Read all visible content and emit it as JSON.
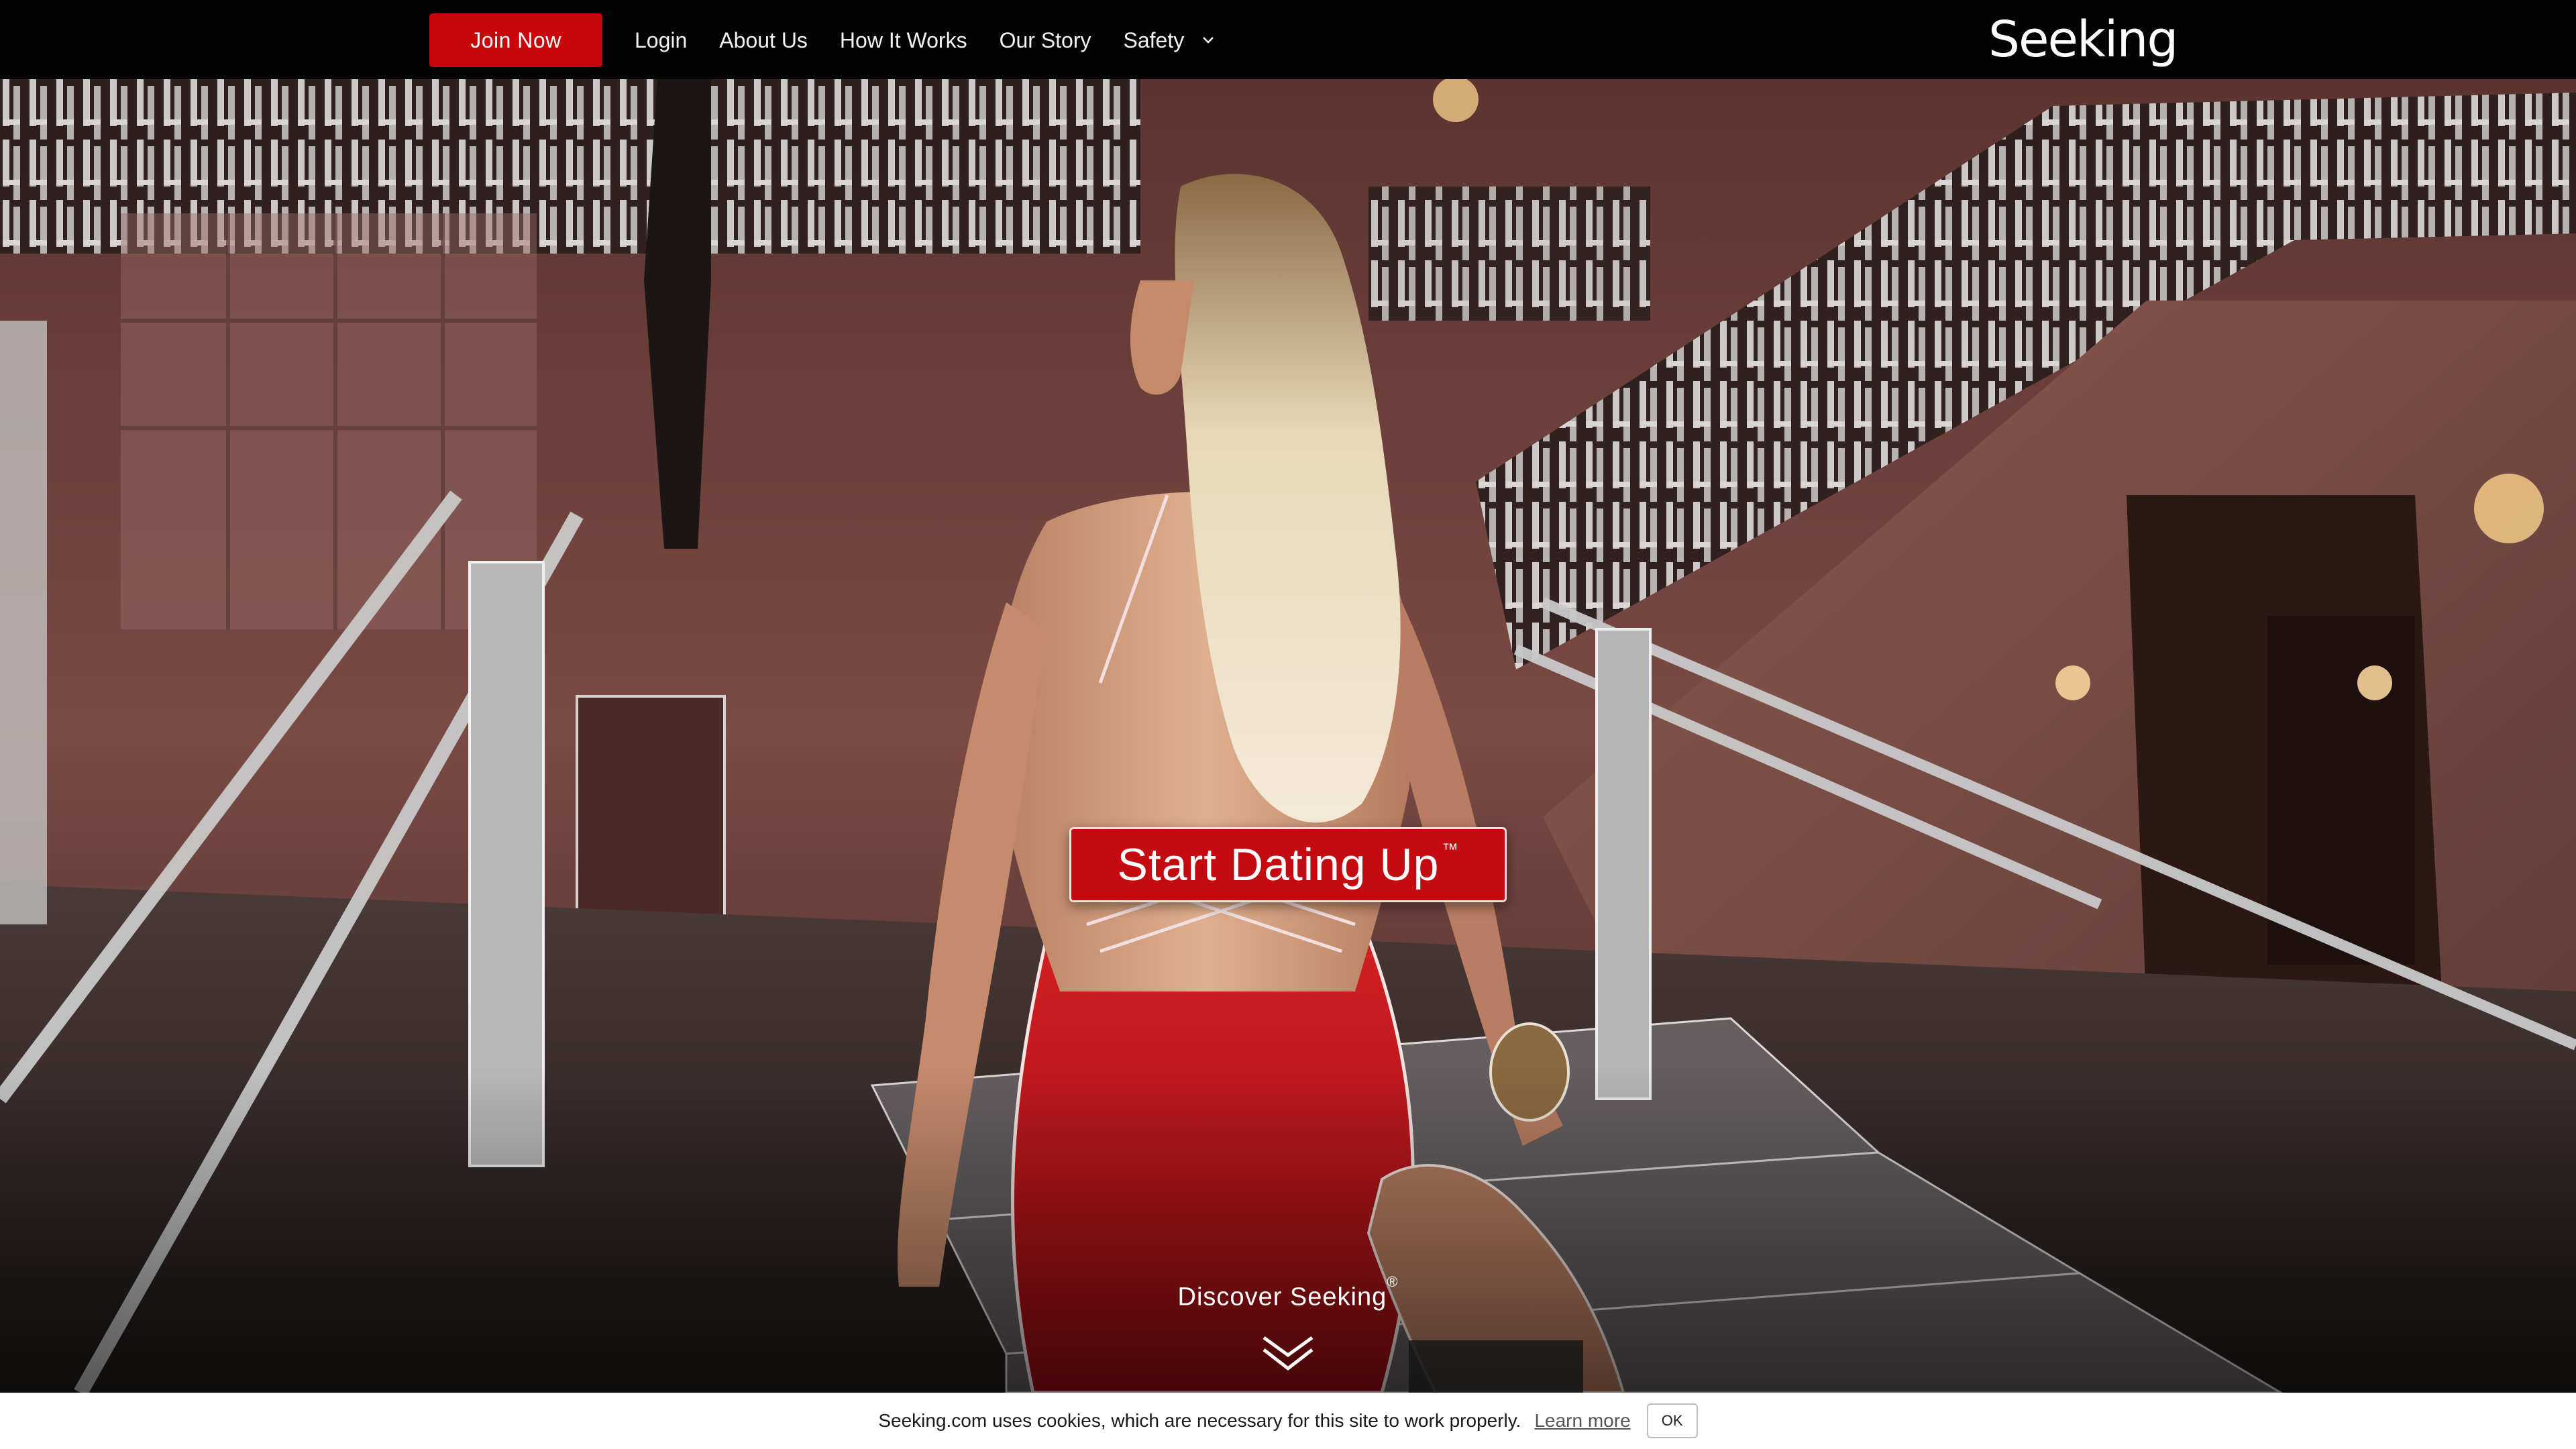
{
  "nav": {
    "join_label": "Join Now",
    "login_label": "Login",
    "about_label": "About Us",
    "how_label": "How It Works",
    "story_label": "Our Story",
    "safety_label": "Safety",
    "logo_text": "Seeking"
  },
  "hero": {
    "cta_label": "Start Dating Up",
    "cta_mark": "™",
    "discover_label": "Discover Seeking",
    "discover_mark": "®"
  },
  "cookie": {
    "message": "Seeking.com uses cookies, which are necessary for this site to work properly.",
    "learn_more": "Learn more",
    "ok_label": "OK"
  },
  "colors": {
    "brand_red": "#c8070d",
    "cta_red": "#c40b12",
    "topbar": "#030303"
  },
  "icons": {
    "safety_dropdown": "chevron-down-icon",
    "discover": "double-chevron-down-icon"
  }
}
